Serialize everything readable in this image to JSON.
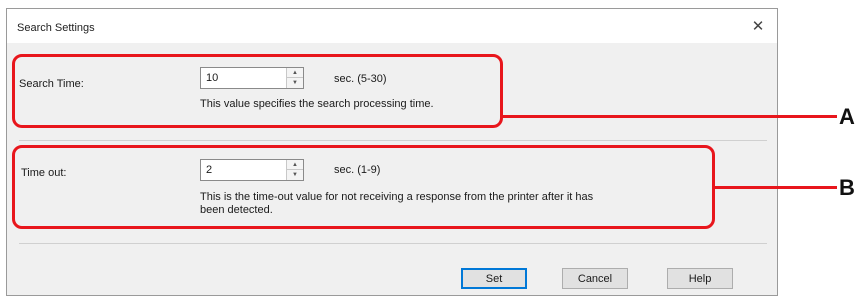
{
  "dialog": {
    "title": "Search Settings",
    "close_glyph": "✕"
  },
  "search_time": {
    "label": "Search Time:",
    "value": "10",
    "range": "sec. (5-30)",
    "description": "This value specifies the search processing time."
  },
  "time_out": {
    "label": "Time out:",
    "value": "2",
    "range": "sec. (1-9)",
    "description_line1": "This is the time-out value for not receiving a response from the printer after it has",
    "description_line2": "been detected."
  },
  "buttons": {
    "set": "Set",
    "cancel": "Cancel",
    "help": "Help"
  },
  "annotations": {
    "a": "A",
    "b": "B"
  },
  "colors": {
    "callout": "#e8161c",
    "dialog_bg": "#f0f0f0",
    "default_button_border": "#0078d7"
  },
  "icons": {
    "close": "close-icon",
    "spin_up": "chevron-up-icon",
    "spin_down": "chevron-down-icon"
  }
}
